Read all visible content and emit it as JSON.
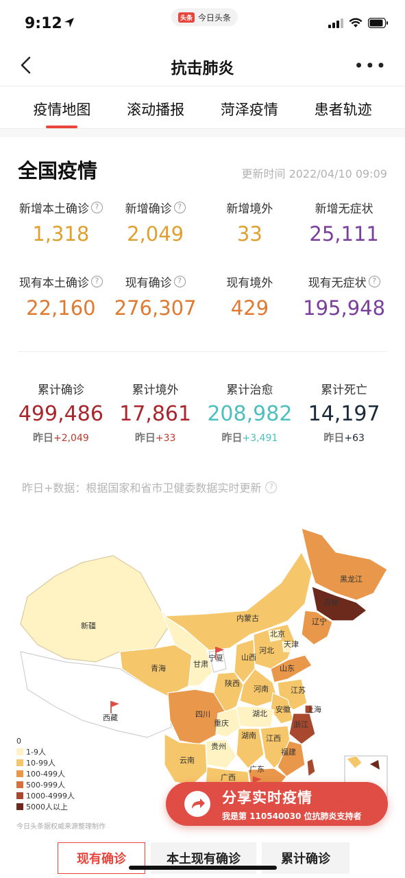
{
  "status_bar": {
    "time": "9:12",
    "app_pill_logo": "头条",
    "app_pill_text": "今日头条"
  },
  "nav": {
    "title": "抗击肺炎"
  },
  "tabs": [
    {
      "label": "疫情地图",
      "active": true
    },
    {
      "label": "滚动播报",
      "active": false
    },
    {
      "label": "菏泽疫情",
      "active": false
    },
    {
      "label": "患者轨迹",
      "active": false
    }
  ],
  "section": {
    "title": "全国疫情",
    "update_time": "更新时间 2022/04/10 09:09"
  },
  "stats_new": [
    {
      "label": "新增本土确诊",
      "value": "1,318",
      "help": true,
      "color": "#e0a030"
    },
    {
      "label": "新增确诊",
      "value": "2,049",
      "help": true,
      "color": "#e0a030"
    },
    {
      "label": "新增境外",
      "value": "33",
      "help": false,
      "color": "#e0a030"
    },
    {
      "label": "新增无症状",
      "value": "25,111",
      "help": false,
      "color": "#7a3e9c"
    }
  ],
  "stats_current": [
    {
      "label": "现有本土确诊",
      "value": "22,160",
      "help": true,
      "color": "#e07a30"
    },
    {
      "label": "现有确诊",
      "value": "276,307",
      "help": true,
      "color": "#e07a30"
    },
    {
      "label": "现有境外",
      "value": "429",
      "help": false,
      "color": "#e07a30"
    },
    {
      "label": "现有无症状",
      "value": "195,948",
      "help": true,
      "color": "#7a3e9c"
    }
  ],
  "stats_total": [
    {
      "label": "累计确诊",
      "value": "499,486",
      "y_label": "昨日",
      "y_delta": "+2,049",
      "color": "#a8262c",
      "delta_color": "#c0392b"
    },
    {
      "label": "累计境外",
      "value": "17,861",
      "y_label": "昨日",
      "y_delta": "+33",
      "color": "#a8262c",
      "delta_color": "#c0392b"
    },
    {
      "label": "累计治愈",
      "value": "208,982",
      "y_label": "昨日",
      "y_delta": "+3,491",
      "color": "#4dbfbf",
      "delta_color": "#4dbfbf"
    },
    {
      "label": "累计死亡",
      "value": "14,197",
      "y_label": "昨日",
      "y_delta": "+63",
      "color": "#1b2a3a",
      "delta_color": "#1b2a3a"
    }
  ],
  "data_note": "昨日+数据：根据国家和省市卫健委数据实时更新",
  "map": {
    "labels": [
      "新疆",
      "西藏",
      "青海",
      "甘肃",
      "宁夏",
      "内蒙古",
      "黑龙江",
      "吉林",
      "辽宁",
      "北京",
      "天津",
      "河北",
      "山西",
      "山东",
      "陕西",
      "河南",
      "江苏",
      "安徽",
      "四川",
      "重庆",
      "湖北",
      "上海",
      "浙江",
      "湖南",
      "江西",
      "贵州",
      "云南",
      "福建",
      "广东",
      "广西"
    ],
    "colors": {
      "level0": "#ffffff",
      "level1": "#fff3c4",
      "level2": "#f6c66a",
      "level3": "#e9974a",
      "level4": "#d4713e",
      "level5": "#a8482e",
      "level6": "#6b2a1c"
    }
  },
  "legend": [
    {
      "label": "0",
      "color": "#ffffff"
    },
    {
      "label": "1-9人",
      "color": "#fff3c4"
    },
    {
      "label": "10-99人",
      "color": "#f6c66a"
    },
    {
      "label": "100-499人",
      "color": "#e9974a"
    },
    {
      "label": "500-999人",
      "color": "#d4713e"
    },
    {
      "label": "1000-4999人",
      "color": "#a8482e"
    },
    {
      "label": "5000人以上",
      "color": "#6b2a1c"
    }
  ],
  "legend_source": "今日头条据权威来源整理制作",
  "share": {
    "title": "分享实时疫情",
    "sub_prefix": "我是第",
    "sub_number": "110540030",
    "sub_suffix": "位抗肺炎支持者"
  },
  "bottom_tabs": [
    {
      "label": "现有确诊",
      "active": true
    },
    {
      "label": "本土现有确诊",
      "active": false
    },
    {
      "label": "累计确诊",
      "active": false
    }
  ]
}
